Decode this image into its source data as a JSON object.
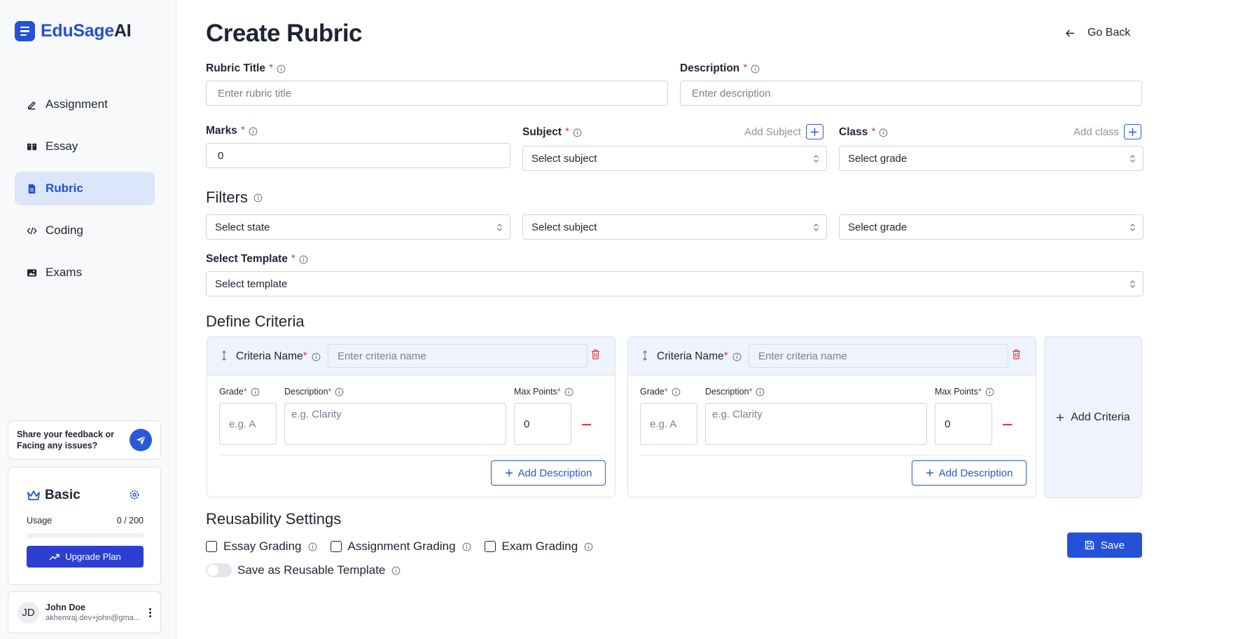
{
  "app": {
    "name_main": "EduSage",
    "name_suffix": "AI"
  },
  "sidebar": {
    "items": [
      {
        "label": "Assignment",
        "icon": "pencil-icon",
        "active": false
      },
      {
        "label": "Essay",
        "icon": "book-icon",
        "active": false
      },
      {
        "label": "Rubric",
        "icon": "document-icon",
        "active": true
      },
      {
        "label": "Coding",
        "icon": "code-icon",
        "active": false
      },
      {
        "label": "Exams",
        "icon": "image-icon",
        "active": false
      }
    ],
    "feedback_text": "Share your feedback or Facing any issues?",
    "plan": {
      "name": "Basic",
      "usage_label": "Usage",
      "usage_value": "0 / 200",
      "usage_fraction": 0,
      "upgrade_label": "Upgrade Plan"
    },
    "user": {
      "initials": "JD",
      "name": "John Doe",
      "email": "akhemraj.dev+john@gma..."
    }
  },
  "header": {
    "title": "Create Rubric",
    "go_back": "Go Back"
  },
  "form": {
    "rubric_title": {
      "label": "Rubric Title",
      "placeholder": "Enter rubric title"
    },
    "description": {
      "label": "Description",
      "placeholder": "Enter description"
    },
    "marks": {
      "label": "Marks",
      "value": "0"
    },
    "subject": {
      "label": "Subject",
      "add_label": "Add Subject",
      "placeholder": "Select subject"
    },
    "class": {
      "label": "Class",
      "add_label": "Add class",
      "placeholder": "Select grade"
    }
  },
  "filters": {
    "title": "Filters",
    "state": "Select state",
    "subject": "Select subject",
    "grade": "Select grade"
  },
  "template": {
    "label": "Select Template",
    "placeholder": "Select template"
  },
  "criteria": {
    "title": "Define Criteria",
    "name_label": "Criteria Name",
    "name_placeholder": "Enter criteria name",
    "grade_label": "Grade",
    "grade_placeholder": "e.g. A",
    "desc_label": "Description",
    "desc_placeholder": "e.g. Clarity",
    "max_label": "Max Points",
    "max_value": "0",
    "add_description": "Add Description",
    "add_criteria": "Add Criteria"
  },
  "reusability": {
    "title": "Reusability Settings",
    "options": [
      "Essay Grading",
      "Assignment Grading",
      "Exam Grading"
    ],
    "toggle_label": "Save as Reusable Template",
    "save_label": "Save"
  },
  "colors": {
    "primary": "#2451d6",
    "active_bg": "#dbe6fb",
    "danger": "#e03a3a"
  }
}
